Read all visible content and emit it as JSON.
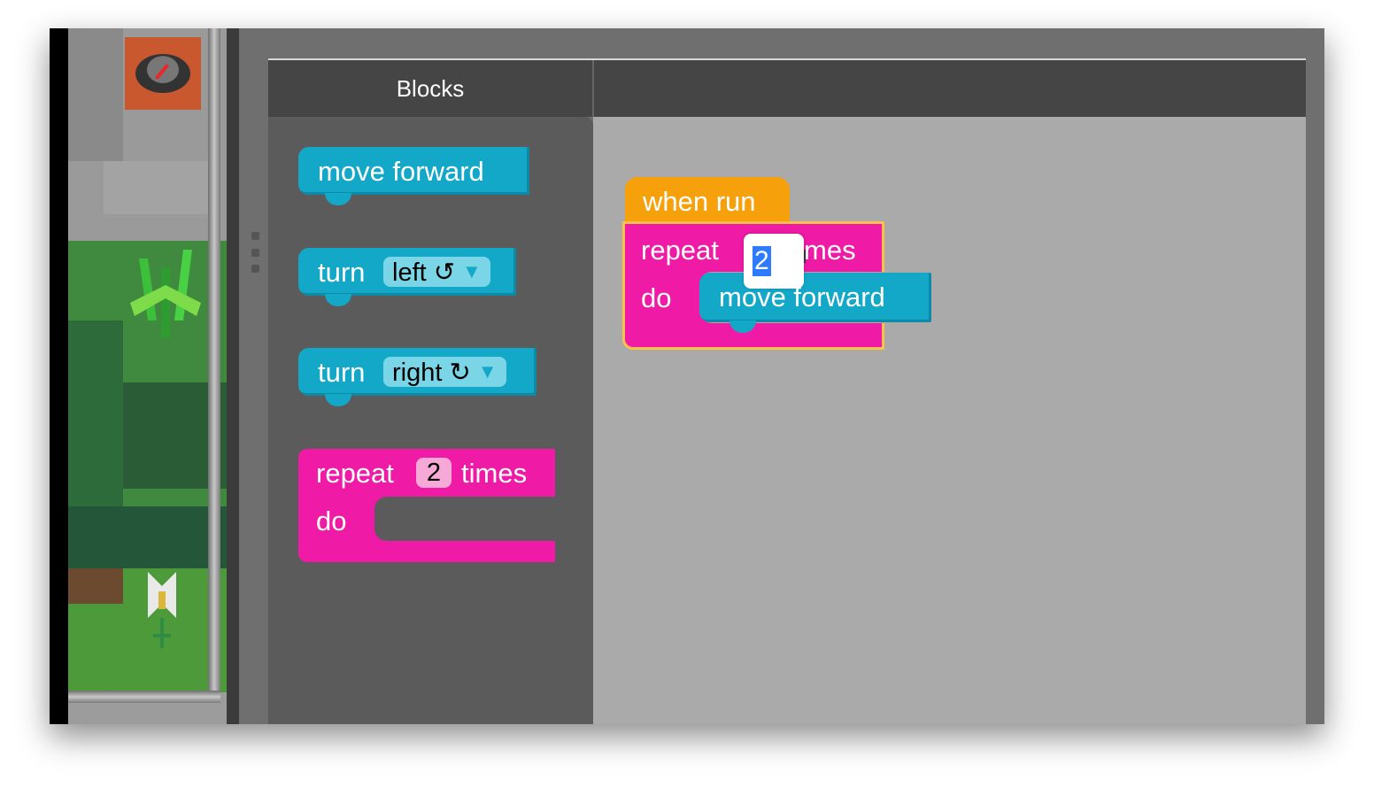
{
  "toolbox": {
    "title": "Blocks",
    "blocks": {
      "move_forward": "move forward",
      "turn_left": {
        "label": "turn",
        "direction": "left ↺",
        "arrow": "▼"
      },
      "turn_right": {
        "label": "turn",
        "direction": "right ↻",
        "arrow": "▼"
      },
      "repeat": {
        "label": "repeat",
        "count": "2",
        "suffix": "times",
        "do": "do"
      }
    }
  },
  "workspace": {
    "event_block": "when run",
    "repeat_block": {
      "label": "repeat",
      "count": "2",
      "suffix": "mes",
      "do": "do"
    },
    "inner_block": "move forward"
  },
  "icons": {
    "agent": "robot-agent-icon",
    "plant": "plant-icon",
    "flower": "flower-icon",
    "cursor": "text-cursor-icon"
  },
  "colors": {
    "movement_block": "#14a8c8",
    "loop_block": "#ef1aa6",
    "event_block": "#f6a10b",
    "workspace_bg": "#aaaaaa",
    "toolbox_bg": "#5b5b5b"
  }
}
